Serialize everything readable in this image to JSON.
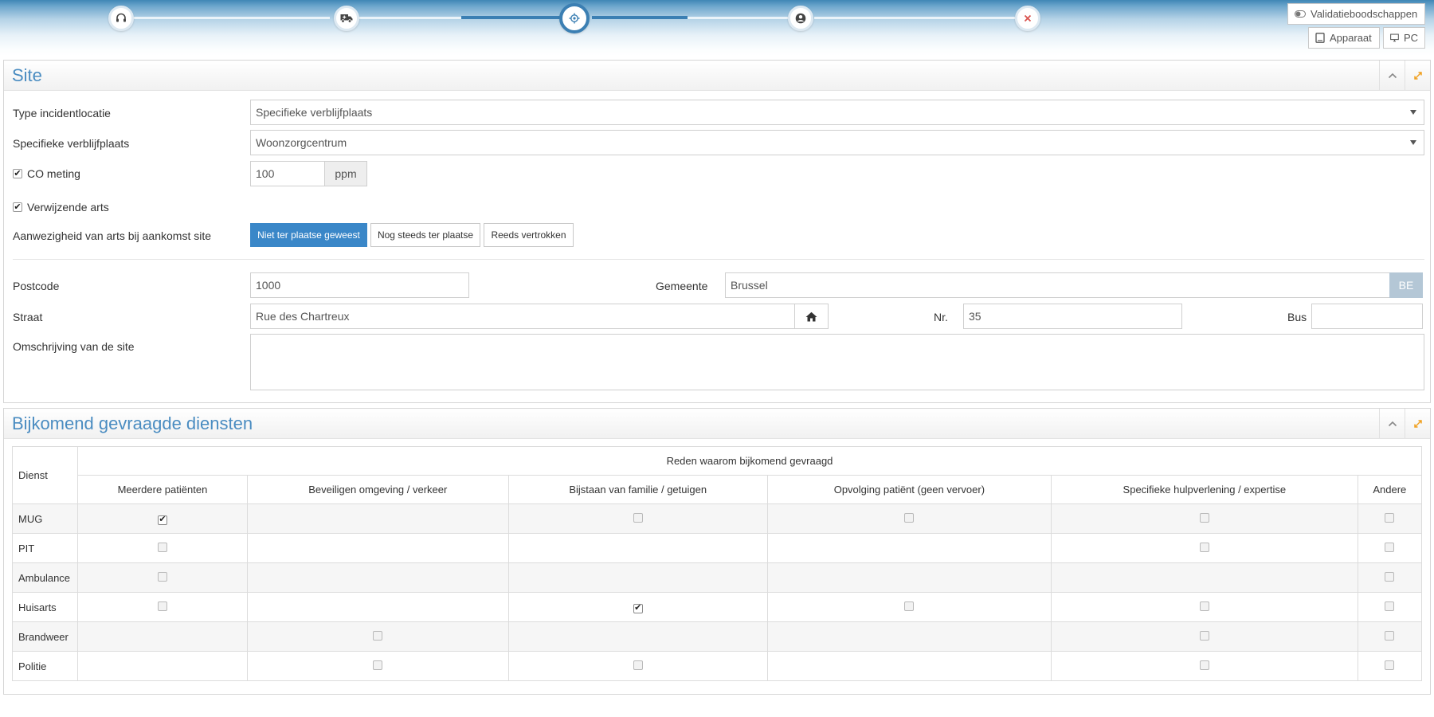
{
  "topbar": {
    "steps": [
      {
        "icon": "headset-icon",
        "state": "done"
      },
      {
        "icon": "ambulance-icon",
        "state": "done"
      },
      {
        "icon": "location-target-icon",
        "state": "current"
      },
      {
        "icon": "user-circle-icon",
        "state": "todo"
      },
      {
        "icon": "close-icon",
        "state": "todo"
      }
    ],
    "validation_label": "Validatieboodschappen",
    "device_label": "Apparaat",
    "pc_label": "PC"
  },
  "site": {
    "title": "Site",
    "type_label": "Type incidentlocatie",
    "type_value": "Specifieke verblijfplaats",
    "residence_label": "Specifieke verblijfplaats",
    "residence_value": "Woonzorgcentrum",
    "co_label": "CO meting",
    "co_checked": true,
    "co_value": "100",
    "co_unit": "ppm",
    "doctor_label": "Verwijzende arts",
    "doctor_checked": true,
    "presence_label": "Aanwezigheid van arts bij aankomst site",
    "presence_options": [
      "Niet ter plaatse geweest",
      "Nog steeds ter plaatse",
      "Reeds vertrokken"
    ],
    "presence_selected": "Niet ter plaatse geweest",
    "postcode_label": "Postcode",
    "postcode_value": "1000",
    "gemeente_label": "Gemeente",
    "gemeente_value": "Brussel",
    "country_code": "BE",
    "straat_label": "Straat",
    "straat_value": "Rue des Chartreux",
    "nr_label": "Nr.",
    "nr_value": "35",
    "bus_label": "Bus",
    "bus_value": "",
    "omschrijving_label": "Omschrijving van de site",
    "omschrijving_value": ""
  },
  "services": {
    "title": "Bijkomend gevraagde diensten",
    "service_header": "Dienst",
    "reason_header": "Reden waarom bijkomend gevraagd",
    "columns": [
      "Meerdere patiënten",
      "Beveiligen omgeving / verkeer",
      "Bijstaan van familie / getuigen",
      "Opvolging patiënt (geen vervoer)",
      "Specifieke hulpverlening / expertise",
      "Andere"
    ],
    "rows": [
      {
        "name": "MUG",
        "cells": [
          "checked",
          "none",
          "empty",
          "empty",
          "empty",
          "empty"
        ]
      },
      {
        "name": "PIT",
        "cells": [
          "empty",
          "none",
          "none",
          "none",
          "empty",
          "empty"
        ]
      },
      {
        "name": "Ambulance",
        "cells": [
          "empty",
          "none",
          "none",
          "none",
          "none",
          "empty"
        ]
      },
      {
        "name": "Huisarts",
        "cells": [
          "empty",
          "none",
          "checked",
          "empty",
          "empty",
          "empty"
        ]
      },
      {
        "name": "Brandweer",
        "cells": [
          "none",
          "empty",
          "none",
          "none",
          "empty",
          "empty"
        ]
      },
      {
        "name": "Politie",
        "cells": [
          "none",
          "empty",
          "empty",
          "none",
          "empty",
          "empty"
        ]
      }
    ]
  },
  "colors": {
    "accent": "#3b7fb3",
    "panel_title": "#4a8cc1",
    "primary_button": "#3a87c8",
    "expand_icon": "#f0a020"
  }
}
